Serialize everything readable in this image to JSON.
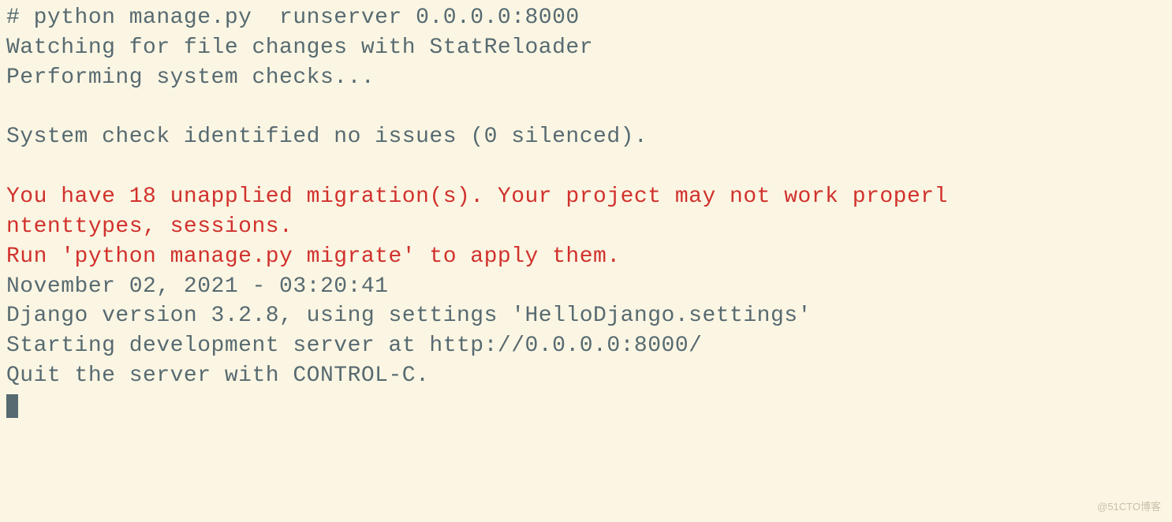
{
  "terminal": {
    "lines": [
      {
        "text": "# python manage.py  runserver 0.0.0.0:8000",
        "color": "gray"
      },
      {
        "text": "Watching for file changes with StatReloader",
        "color": "gray"
      },
      {
        "text": "Performing system checks...",
        "color": "gray"
      },
      {
        "text": "",
        "color": "blank"
      },
      {
        "text": "System check identified no issues (0 silenced).",
        "color": "gray"
      },
      {
        "text": "",
        "color": "blank"
      },
      {
        "text": "You have 18 unapplied migration(s). Your project may not work properl",
        "color": "red"
      },
      {
        "text": "ntenttypes, sessions.",
        "color": "red"
      },
      {
        "text": "Run 'python manage.py migrate' to apply them.",
        "color": "red"
      },
      {
        "text": "November 02, 2021 - 03:20:41",
        "color": "gray"
      },
      {
        "text": "Django version 3.2.8, using settings 'HelloDjango.settings'",
        "color": "gray"
      },
      {
        "text": "Starting development server at http://0.0.0.0:8000/",
        "color": "gray"
      },
      {
        "text": "Quit the server with CONTROL-C.",
        "color": "gray"
      }
    ]
  },
  "watermark": "@51CTO博客"
}
